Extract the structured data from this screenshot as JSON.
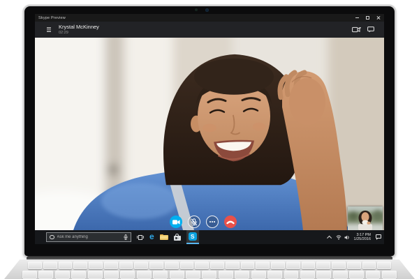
{
  "window": {
    "app_title": "Skype Preview",
    "controls": [
      "minimize",
      "maximize",
      "close"
    ]
  },
  "call": {
    "contact_name": "Krystal McKinney",
    "call_timer": "02:29",
    "header_actions": [
      "add-video-camera",
      "open-chat"
    ],
    "control_buttons": [
      "toggle-video",
      "toggle-mute",
      "more-options",
      "end-call"
    ]
  },
  "taskbar": {
    "search_placeholder": "Ask me anything",
    "edge_glyph": "e",
    "skype_glyph": "S",
    "pinned_items": [
      "start",
      "cortana-search",
      "task-view",
      "edge",
      "file-explorer",
      "store",
      "skype"
    ],
    "tray": {
      "time": "3:17 PM",
      "date": "1/25/2016",
      "icons": [
        "expand-chevron",
        "network",
        "volume",
        "action-center"
      ]
    }
  },
  "icons": {
    "menu": "hamburger-lines",
    "add_video": "camera-plus",
    "open_chat": "speech-bubble",
    "toggle_video": "video-camera",
    "toggle_mute": "microphone-slash",
    "more_options": "three-dots",
    "end_call": "phone-down",
    "start": "windows-logo",
    "cortana": "ring",
    "search_mic": "microphone",
    "action_center": "speech-bubble"
  },
  "colors": {
    "skype_blue": "#00aff0",
    "end_call_red": "#e8514a",
    "active_app_underline": "#58b6f0",
    "taskbar_bg": "#16181b",
    "sweater_blue": "#4d7fc4"
  }
}
